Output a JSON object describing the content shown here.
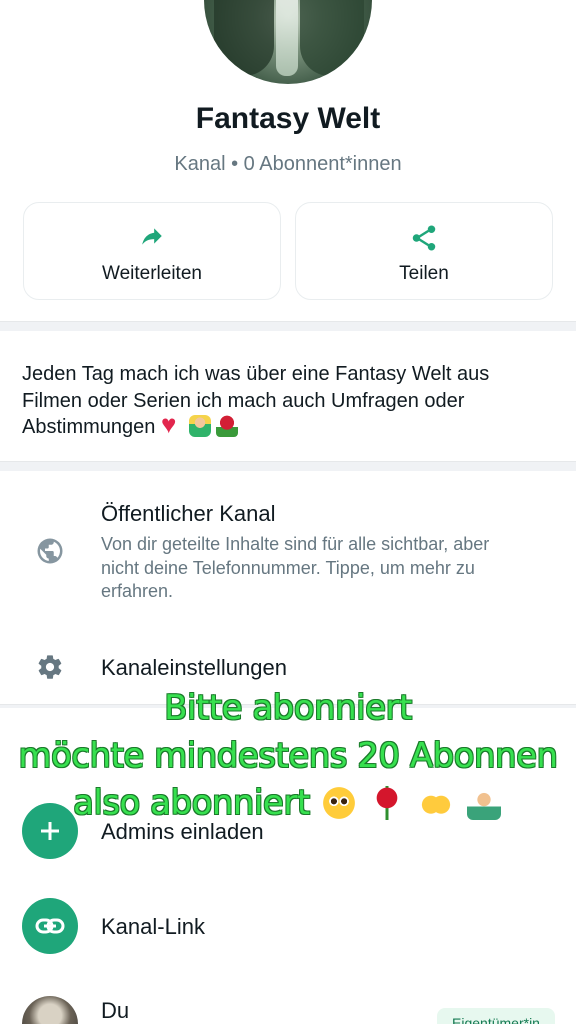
{
  "channel": {
    "name": "Fantasy Welt",
    "subtitle": "Kanal • 0 Abonnent*innen"
  },
  "actions": [
    {
      "label": "Weiterleiten",
      "icon": "forward-icon"
    },
    {
      "label": "Teilen",
      "icon": "share-icon"
    }
  ],
  "description": "Jeden Tag mach ich was über eine Fantasy Welt aus Filmen oder Serien ich mach auch Umfragen oder Abstimmungen",
  "public_channel": {
    "title": "Öffentlicher Kanal",
    "text": "Von dir geteilte Inhalte sind für alle sichtbar, aber nicht deine Telefonnummer. Tippe, um mehr zu erfahren."
  },
  "settings": {
    "title": "Kanaleinstellungen"
  },
  "admins": {
    "label": "Admins einladen"
  },
  "channel_link": {
    "label": "Kanal-Link"
  },
  "owner": {
    "name": "Du",
    "badge": "Eigentümer*in"
  },
  "overlay": {
    "line1": "Bitte abonniert",
    "line2": "möchte mindestens 20 Abonnen",
    "line3": "also abonniert"
  },
  "colors": {
    "accent": "#1fa67a",
    "overlay_text": "#37e04f"
  }
}
